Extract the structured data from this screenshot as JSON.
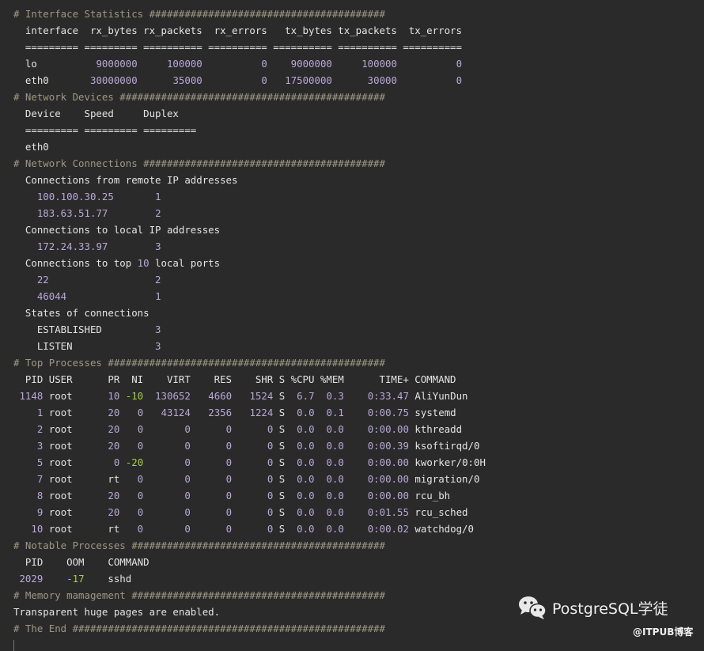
{
  "terminal": {
    "lines": [
      "# Interface Statistics ########################################",
      "  interface  rx_bytes rx_packets  rx_errors   tx_bytes tx_packets  tx_errors",
      "  ========= ========= ========== ========== ========== ========== ==========",
      "  lo          9000000     100000          0    9000000     100000          0",
      "  eth0       30000000      35000          0   17500000      30000          0",
      "# Network Devices #############################################",
      "  Device    Speed     Duplex",
      "  ========= ========= =========",
      "  eth0",
      "# Network Connections #########################################",
      "  Connections from remote IP addresses",
      "    100.100.30.25       1",
      "    183.63.51.77        2",
      "  Connections to local IP addresses",
      "    172.24.33.97        3",
      "  Connections to top 10 local ports",
      "    22                  2",
      "    46044               1",
      "  States of connections",
      "    ESTABLISHED         3",
      "    LISTEN              3",
      "# Top Processes ###############################################",
      "  PID USER      PR  NI    VIRT    RES    SHR S %CPU %MEM      TIME+ COMMAND",
      " 1148 root      10 -10  130652   4660   1524 S  6.7  0.3    0:33.47 AliYunDun",
      "    1 root      20   0   43124   2356   1224 S  0.0  0.1    0:00.75 systemd",
      "    2 root      20   0       0      0      0 S  0.0  0.0    0:00.00 kthreadd",
      "    3 root      20   0       0      0      0 S  0.0  0.0    0:00.39 ksoftirqd/0",
      "    5 root       0 -20       0      0      0 S  0.0  0.0    0:00.00 kworker/0:0H",
      "    7 root      rt   0       0      0      0 S  0.0  0.0    0:00.00 migration/0",
      "    8 root      20   0       0      0      0 S  0.0  0.0    0:00.00 rcu_bh",
      "    9 root      20   0       0      0      0 S  0.0  0.0    0:01.55 rcu_sched",
      "   10 root      rt   0       0      0      0 S  0.0  0.0    0:00.02 watchdog/0",
      "# Notable Processes ###########################################",
      "  PID    OOM    COMMAND",
      " 2029    -17    sshd",
      "# Memory mamagement ###########################################",
      "Transparent huge pages are enabled.",
      "# The End #####################################################"
    ]
  },
  "watermark": {
    "icon": "wechat-icon",
    "account": "PostgreSQL学徒",
    "source": "@ITPUB博客"
  },
  "colors": {
    "background": "#2a2a2a",
    "text": "#e4e4e4",
    "comment": "#9c9985",
    "number": "#b9a8d8",
    "negative": "#a6d13a"
  }
}
